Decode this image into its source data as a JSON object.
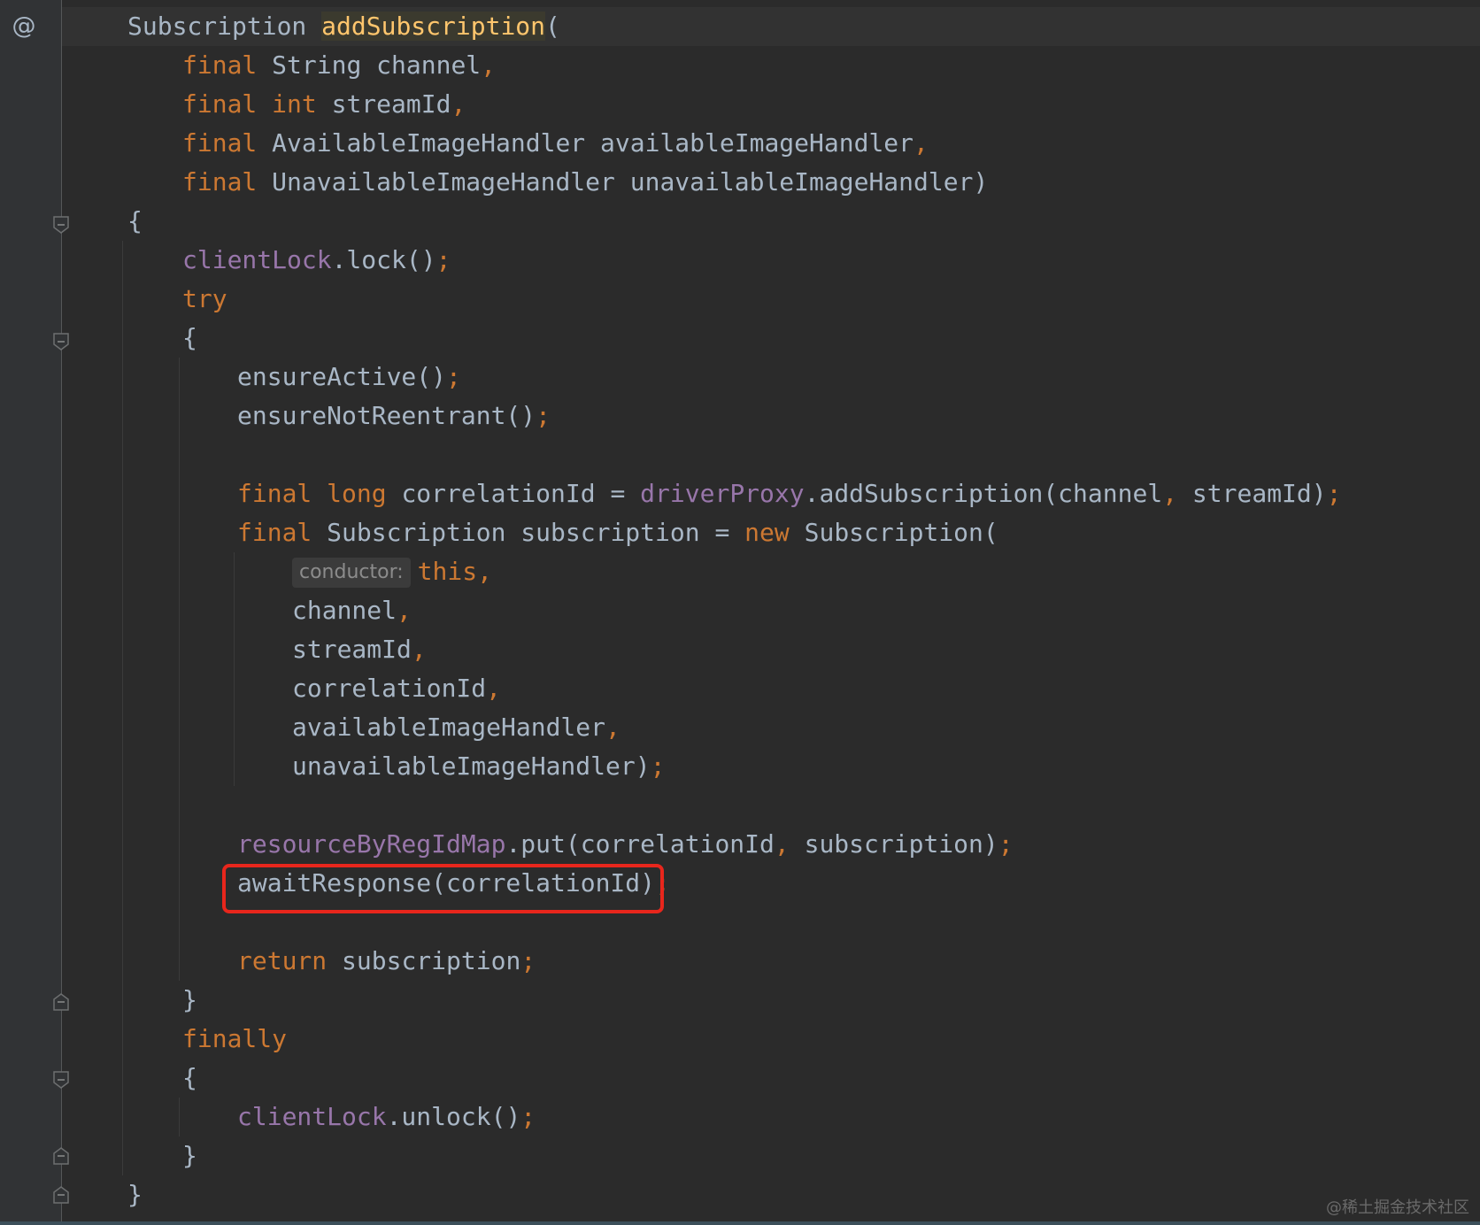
{
  "editor": {
    "gutter_icon": "@",
    "gutter_icon_name": "annotation-at-icon",
    "lines": [
      {
        "t": [
          [
            "Subscription ",
            ""
          ],
          [
            "addSubscription",
            "fn-decl"
          ],
          [
            "(",
            ""
          ]
        ]
      },
      {
        "t": [
          [
            "final ",
            "kw"
          ],
          [
            "String channel",
            ""
          ],
          [
            ",",
            "punct"
          ]
        ]
      },
      {
        "t": [
          [
            "final ",
            "kw"
          ],
          [
            "int ",
            "kw"
          ],
          [
            "streamId",
            ""
          ],
          [
            ",",
            "punct"
          ]
        ]
      },
      {
        "t": [
          [
            "final ",
            "kw"
          ],
          [
            "AvailableImageHandler availableImageHandler",
            ""
          ],
          [
            ",",
            "punct"
          ]
        ]
      },
      {
        "t": [
          [
            "final ",
            "kw"
          ],
          [
            "UnavailableImageHandler unavailableImageHandler)",
            ""
          ]
        ]
      },
      {
        "t": [
          [
            "{",
            ""
          ]
        ]
      },
      {
        "t": [
          [
            "clientLock",
            "field"
          ],
          [
            ".lock()",
            ""
          ],
          [
            ";",
            "punct"
          ]
        ]
      },
      {
        "t": [
          [
            "try",
            "kw"
          ]
        ]
      },
      {
        "t": [
          [
            "{",
            ""
          ]
        ]
      },
      {
        "t": [
          [
            "ensureActive()",
            ""
          ],
          [
            ";",
            "punct"
          ]
        ]
      },
      {
        "t": [
          [
            "ensureNotReentrant()",
            ""
          ],
          [
            ";",
            "punct"
          ]
        ]
      },
      {
        "t": []
      },
      {
        "t": [
          [
            "final ",
            "kw"
          ],
          [
            "long ",
            "kw"
          ],
          [
            "correlationId = ",
            ""
          ],
          [
            "driverProxy",
            "field"
          ],
          [
            ".addSubscription(channel",
            ""
          ],
          [
            ", ",
            "punct"
          ],
          [
            "streamId)",
            ""
          ],
          [
            ";",
            "punct"
          ]
        ]
      },
      {
        "t": [
          [
            "final ",
            "kw"
          ],
          [
            "Subscription subscription = ",
            ""
          ],
          [
            "new ",
            "kw"
          ],
          [
            "Subscription(",
            ""
          ]
        ]
      },
      {
        "hint": "conductor:",
        "t": [
          [
            "this",
            "kw"
          ],
          [
            ",",
            "punct"
          ]
        ]
      },
      {
        "t": [
          [
            "channel",
            ""
          ],
          [
            ",",
            "punct"
          ]
        ]
      },
      {
        "t": [
          [
            "streamId",
            ""
          ],
          [
            ",",
            "punct"
          ]
        ]
      },
      {
        "t": [
          [
            "correlationId",
            ""
          ],
          [
            ",",
            "punct"
          ]
        ]
      },
      {
        "t": [
          [
            "availableImageHandler",
            ""
          ],
          [
            ",",
            "punct"
          ]
        ]
      },
      {
        "t": [
          [
            "unavailableImageHandler)",
            ""
          ],
          [
            ";",
            "punct"
          ]
        ]
      },
      {
        "t": []
      },
      {
        "t": [
          [
            "resourceByRegIdMap",
            "field"
          ],
          [
            ".put(correlationId",
            ""
          ],
          [
            ", ",
            "punct"
          ],
          [
            "subscription)",
            ""
          ],
          [
            ";",
            "punct"
          ]
        ]
      },
      {
        "t": [
          [
            "awaitResponse(correlationId)",
            ""
          ],
          [
            ";",
            "punct"
          ]
        ]
      },
      {
        "t": []
      },
      {
        "t": [
          [
            "return ",
            "kw"
          ],
          [
            "subscription",
            ""
          ],
          [
            ";",
            "punct"
          ]
        ]
      },
      {
        "t": [
          [
            "}",
            ""
          ]
        ]
      },
      {
        "t": [
          [
            "finally",
            "kw"
          ]
        ]
      },
      {
        "t": [
          [
            "{",
            ""
          ]
        ]
      },
      {
        "t": [
          [
            "clientLock",
            "field"
          ],
          [
            ".unlock()",
            ""
          ],
          [
            ";",
            "punct"
          ]
        ]
      },
      {
        "t": [
          [
            "}",
            ""
          ]
        ]
      },
      {
        "t": [
          [
            "}",
            ""
          ]
        ]
      }
    ]
  },
  "colors": {
    "background": "#2b2b2b",
    "keyword": "#cc7832",
    "method_declaration": "#ffc66d",
    "field": "#9876aa",
    "default_text": "#a9b7c6",
    "highlight_box": "#e8261c"
  },
  "watermark": "@稀土掘金技术社区"
}
